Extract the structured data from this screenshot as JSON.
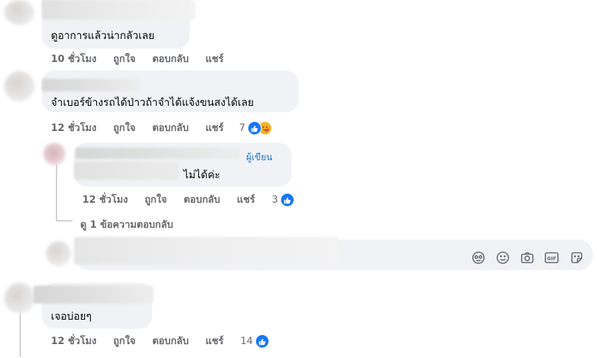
{
  "comments": [
    {
      "text": "ดูอาการแล้วน่ากลัวเลย",
      "time": "10 ชั่วโมง",
      "like": "ถูกใจ",
      "reply": "ตอบกลับ",
      "share": "แชร์"
    },
    {
      "text": "จำเบอร์ข้างรถได้ป่าวถ้าจำได้แจ้งขนสงได้เลย",
      "time": "12 ชั่วโมง",
      "like": "ถูกใจ",
      "reply": "ตอบกลับ",
      "share": "แชร์",
      "reaction_count": "7",
      "reactions": [
        "like-icon",
        "care-icon"
      ]
    },
    {
      "author_badge": "ผู้เขียน",
      "text": "ไม่ได้ค่ะ",
      "time": "12 ชั่วโมง",
      "like": "ถูกใจ",
      "reply": "ตอบกลับ",
      "share": "แชร์",
      "reaction_count": "3",
      "reactions": [
        "like-icon"
      ]
    },
    {
      "text": "เจอบ่อยๆ",
      "time": "12 ชั่วโมง",
      "like": "ถูกใจ",
      "reply": "ตอบกลับ",
      "share": "แชร์",
      "reaction_count": "14",
      "reactions": [
        "like-icon"
      ]
    }
  ],
  "view_replies": "ดู 1 ข้อความตอบกลับ",
  "composer": {
    "tools": [
      "avatar-sticker-icon",
      "emoji-icon",
      "camera-icon",
      "gif-icon",
      "sticker-icon"
    ]
  },
  "colors": {
    "bubble": "#f0f2f5",
    "meta": "#65676b",
    "like_blue": "#1877f2",
    "author_badge": "#1a73c8"
  }
}
